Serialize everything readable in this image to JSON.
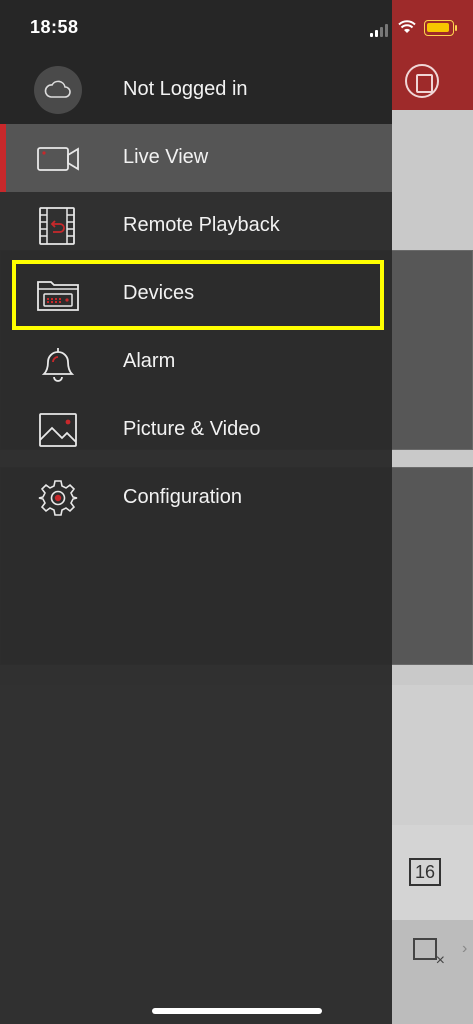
{
  "status_bar": {
    "time": "18:58"
  },
  "drawer": {
    "account_label": "Not Logged in",
    "items": [
      {
        "label": "Live View",
        "icon": "video-camera-icon",
        "selected": true
      },
      {
        "label": "Remote Playback",
        "icon": "film-playback-icon"
      },
      {
        "label": "Devices",
        "icon": "folder-device-icon",
        "highlighted": true
      },
      {
        "label": "Alarm",
        "icon": "bell-icon"
      },
      {
        "label": "Picture & Video",
        "icon": "picture-icon"
      },
      {
        "label": "Configuration",
        "icon": "gear-icon"
      }
    ]
  },
  "background_app": {
    "layout_option": "16"
  },
  "colors": {
    "accent": "#c8282b",
    "highlight": "#ffff00",
    "drawer_bg": "#2a2a2a",
    "selected_bg": "#555555"
  }
}
